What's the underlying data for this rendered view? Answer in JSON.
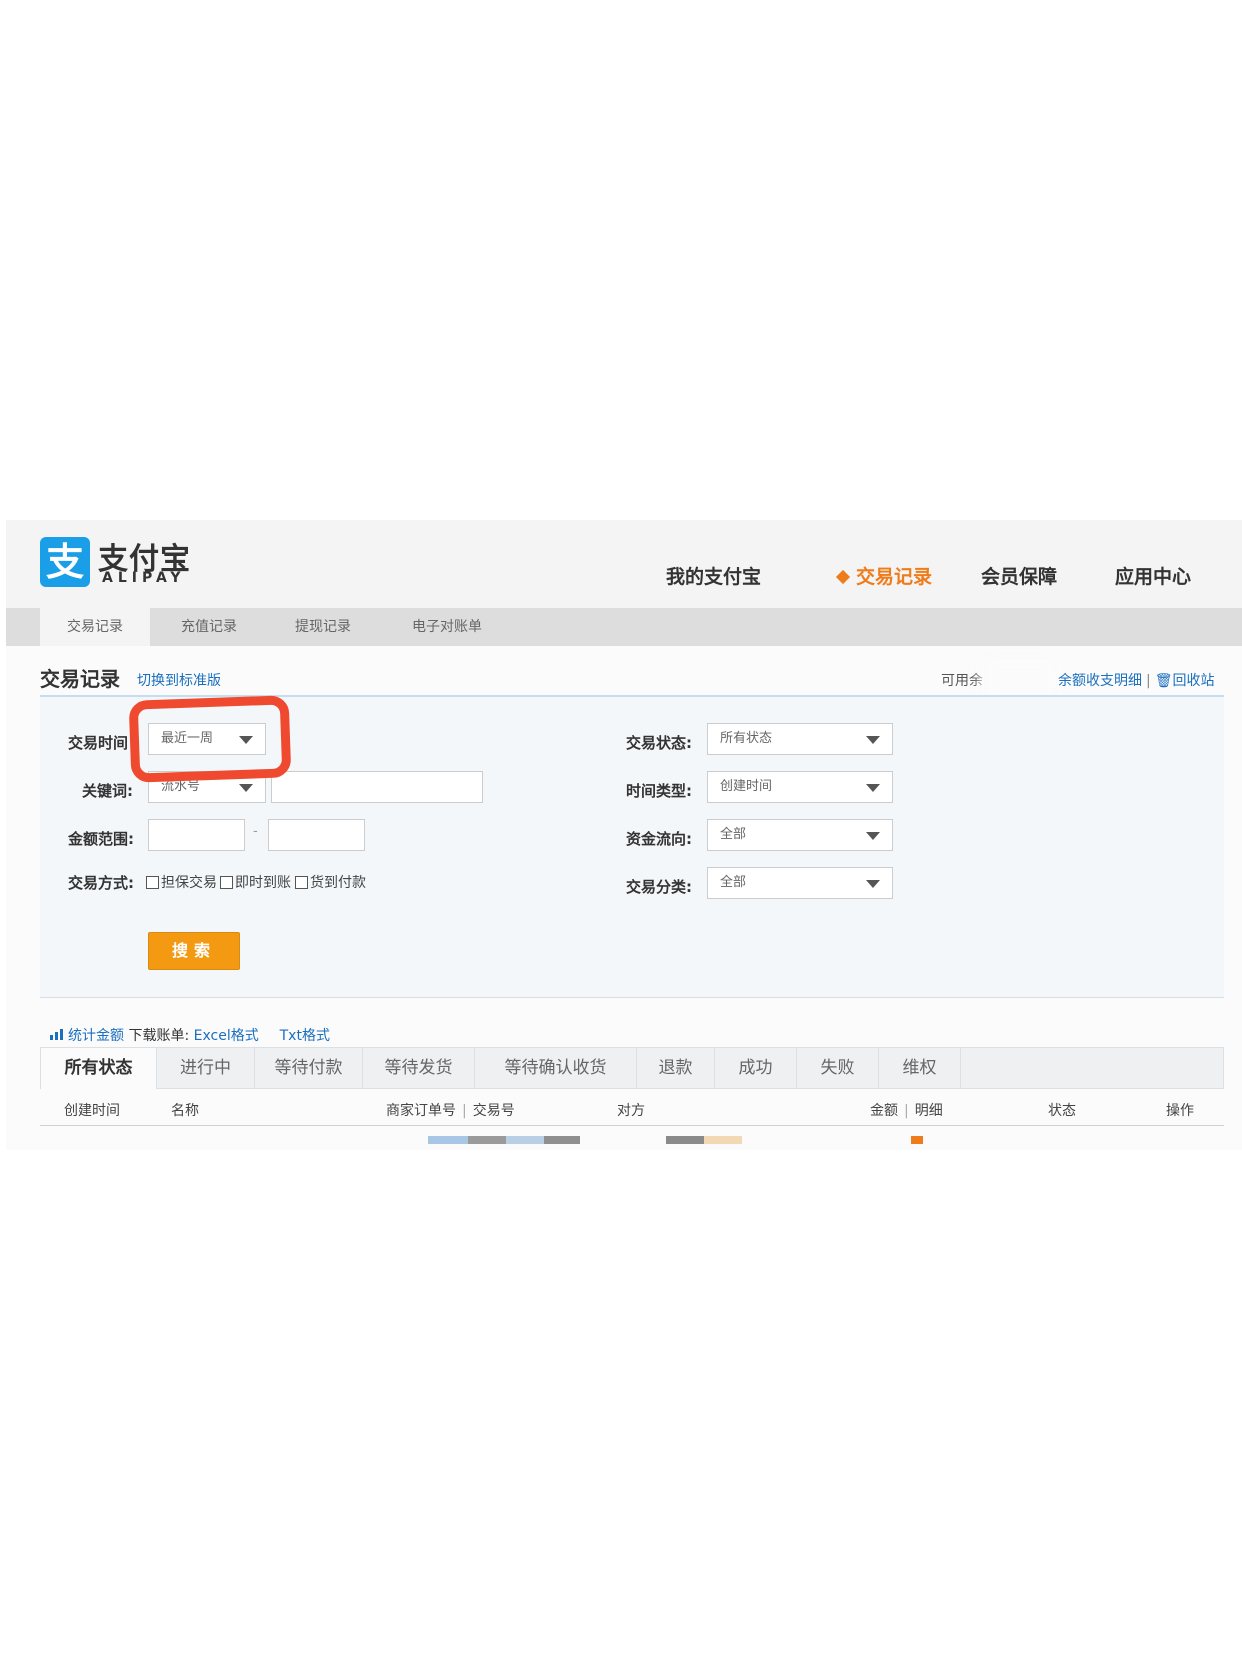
{
  "brand": {
    "logo_glyph": "支",
    "name_cn": "支付宝",
    "name_en": "ALIPAY",
    "color": "#1a9ee8"
  },
  "main_nav": [
    "我的支付宝",
    "交易记录",
    "会员保障",
    "应用中心"
  ],
  "sub_nav": [
    "交易记录",
    "充值记录",
    "提现记录",
    "电子对账单"
  ],
  "page": {
    "title": "交易记录",
    "switch_link": "切换到标准版",
    "available_balance_label": "可用余",
    "balance_detail_link": "余额收支明细",
    "recycle_link": "回收站"
  },
  "form": {
    "time_label": "交易时间",
    "time_value": "最近一周",
    "keyword_label": "关键词:",
    "keyword_type": "流水号",
    "amount_label": "金额范围:",
    "amount_sep": "-",
    "method_label": "交易方式:",
    "methods": [
      "担保交易",
      "即时到账",
      "货到付款"
    ],
    "status_label": "交易状态:",
    "status_value": "所有状态",
    "time_type_label": "时间类型:",
    "time_type_value": "创建时间",
    "flow_label": "资金流向:",
    "flow_value": "全部",
    "category_label": "交易分类:",
    "category_value": "全部",
    "search_button": "搜索"
  },
  "stats": {
    "total_link": "统计金额",
    "download_label": "下载账单:",
    "excel_link": "Excel格式",
    "txt_link": "Txt格式"
  },
  "status_tabs": [
    "所有状态",
    "进行中",
    "等待付款",
    "等待发货",
    "等待确认收货",
    "退款",
    "成功",
    "失败",
    "维权"
  ],
  "columns": {
    "created": "创建时间",
    "name": "名称",
    "merchant_order": "商家订单号",
    "trade_no": "交易号",
    "counterparty": "对方",
    "amount": "金额",
    "detail": "明细",
    "status": "状态",
    "action": "操作"
  },
  "colors": {
    "accent": "#ef7c1a",
    "link": "#1a6fbf",
    "button": "#f39a12",
    "annotation": "#ef4a30"
  }
}
